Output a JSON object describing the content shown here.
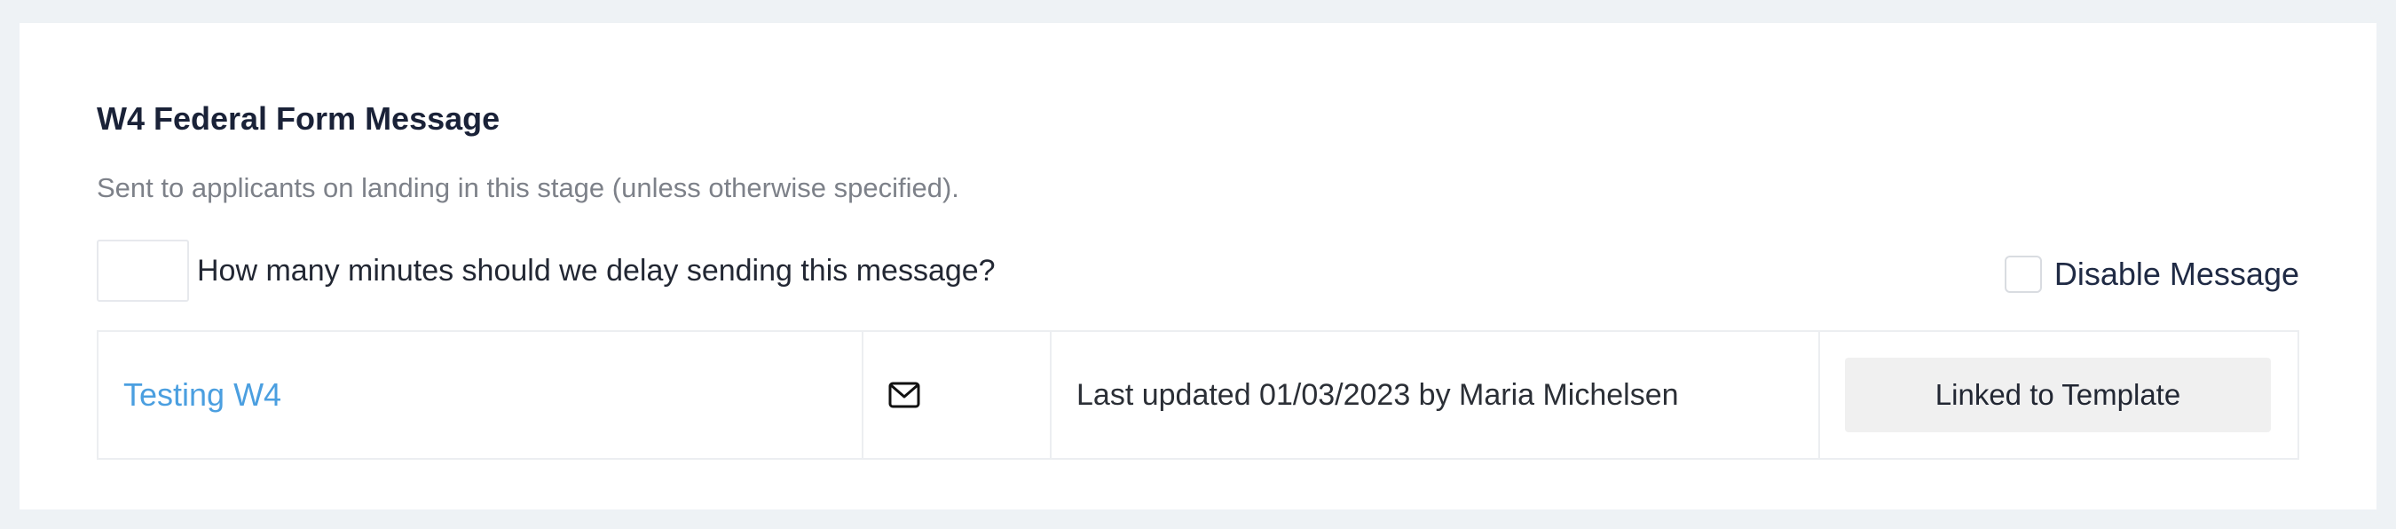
{
  "section": {
    "title": "W4 Federal Form Message",
    "subtitle": "Sent to applicants on landing in this stage (unless otherwise specified)."
  },
  "delay": {
    "value": "",
    "label": "How many minutes should we delay sending this message?"
  },
  "disable": {
    "label": "Disable Message",
    "checked": false
  },
  "message": {
    "template_name": "Testing W4",
    "icon": "mail-icon",
    "last_updated": "Last updated 01/03/2023 by Maria Michelsen",
    "status_button": "Linked to Template"
  },
  "colors": {
    "background": "#eef2f5",
    "card": "#ffffff",
    "link": "#4b9fe0",
    "button_bg": "#f0f0f0",
    "title": "#1a2238"
  }
}
